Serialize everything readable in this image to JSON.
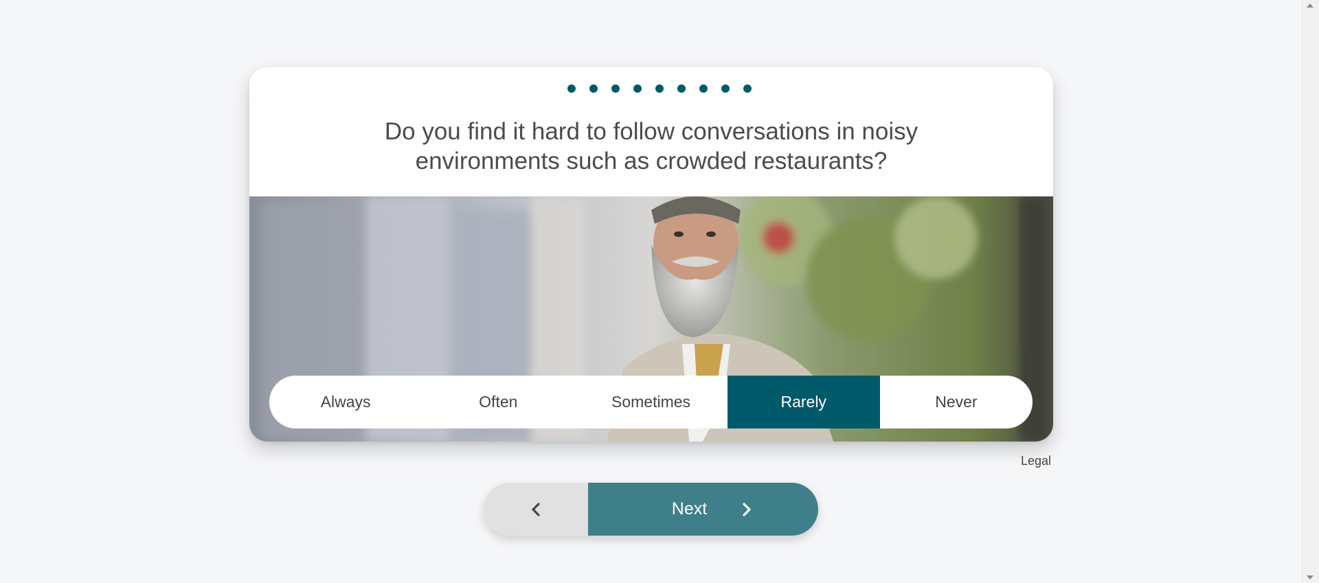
{
  "progress": {
    "total_dots": 9
  },
  "question": {
    "line1": "Do you find it hard to follow conversations in noisy",
    "line2": "environments such as crowded restaurants?"
  },
  "answers": {
    "options": [
      "Always",
      "Often",
      "Sometimes",
      "Rarely",
      "Never"
    ],
    "selected": "Rarely"
  },
  "footer": {
    "legal": "Legal"
  },
  "nav": {
    "next_label": "Next",
    "back_icon": "chevron-left-icon",
    "next_icon": "chevron-right-icon"
  },
  "colors": {
    "accent": "#005a6a",
    "next_bg": "#3f7f8a",
    "back_bg": "#e1e1e1",
    "page_bg": "#f5f6f8"
  }
}
